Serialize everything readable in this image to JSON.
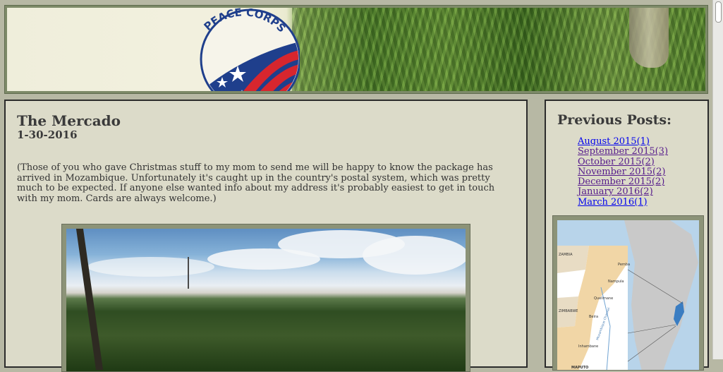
{
  "header": {
    "logo_text": "PEACE CORPS"
  },
  "post": {
    "title": "The Mercado",
    "date": "1-30-2016",
    "body": "(Those of you who gave Christmas stuff to my mom to send me will be happy to know the package has arrived in Mozambique. Unfortunately it's caught up in the country's postal system, which was pretty much to be expected. If anyone else wanted info about my address it's probably easiest to get in touch with my mom. Cards are always welcome.)"
  },
  "sidebar": {
    "title": "Previous Posts:",
    "archive": [
      {
        "label": "August 2015(1)",
        "visited": false
      },
      {
        "label": "September 2015(3)",
        "visited": true
      },
      {
        "label": "October 2015(2)",
        "visited": true
      },
      {
        "label": "November 2015(2)",
        "visited": true
      },
      {
        "label": "December 2015(2)",
        "visited": true
      },
      {
        "label": "January 2016(2)",
        "visited": true
      },
      {
        "label": "March 2016(1)",
        "visited": false
      }
    ],
    "map_labels": [
      "ZAMBIA",
      "ZIMBABWE",
      "Quelimane",
      "Beira",
      "Inhambane",
      "MAPUTO",
      "Pemba",
      "Nampula",
      "Mozambique Channel"
    ]
  },
  "colors": {
    "page_bg": "#b7b8a4",
    "panel_bg": "#dcdbc9",
    "frame": "#8c9378",
    "link": "#0000ee",
    "visited_link": "#551a8b",
    "logo_blue": "#1f3f8c",
    "logo_red": "#d7262e"
  }
}
